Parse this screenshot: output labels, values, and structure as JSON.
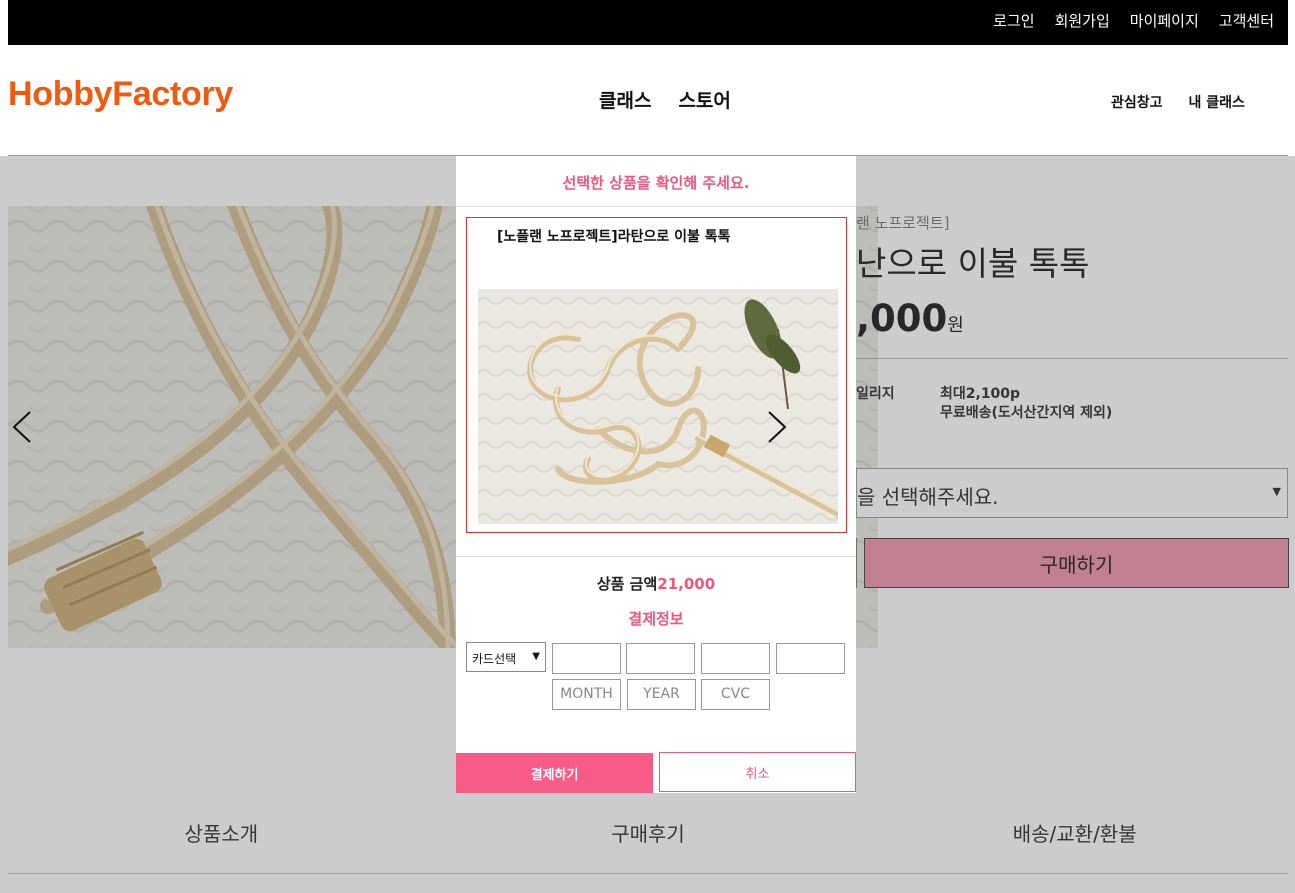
{
  "topbar": {
    "links": [
      "로그인",
      "회원가입",
      "마이페이지",
      "고객센터"
    ]
  },
  "header": {
    "logo": "HobbyFactory",
    "nav": [
      "클래스",
      "스토어"
    ],
    "subnav": [
      "관심창고",
      "내 클래스"
    ]
  },
  "product": {
    "brand_partial": "랜 노프로젝트]",
    "title_partial": "난으로 이불 톡톡",
    "price_partial": ",000",
    "price_unit": "원",
    "mileage_label_partial": "일리지",
    "mileage_value": "최대2,100p",
    "delivery_value": "무료배송(도서산간지역 제외)",
    "option_placeholder_partial": "을 선택해주세요.",
    "buy_label": "구매하기"
  },
  "tabs": [
    "상품소개",
    "구매후기",
    "배송/교환/환불"
  ],
  "modal": {
    "title": "선택한 상품을 확인해 주세요.",
    "item_name": "[노플랜 노프로젝트]라탄으로 이불 톡톡",
    "sum_label": "상품 금액",
    "sum_amount": "21,000",
    "pay_info_label": "결제정보",
    "card_select_value": "카드선택",
    "month_placeholder": "MONTH",
    "year_placeholder": "YEAR",
    "cvc_placeholder": "CVC",
    "pay_label": "결제하기",
    "cancel_label": "취소"
  },
  "colors": {
    "accent": "#f0557e",
    "logo": "#f05a0f",
    "topbar": "#000000"
  }
}
